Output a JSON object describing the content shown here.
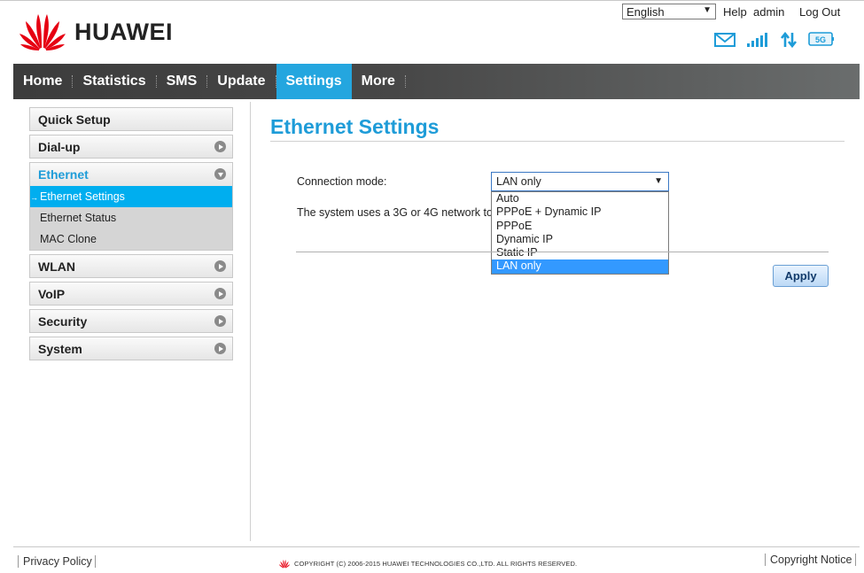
{
  "brand": {
    "name": "HUAWEI"
  },
  "header": {
    "language": "English",
    "help": "Help",
    "user": "admin",
    "logout": "Log Out",
    "network_badge": "5G"
  },
  "nav": {
    "items": [
      {
        "label": "Home",
        "active": false
      },
      {
        "label": "Statistics",
        "active": false
      },
      {
        "label": "SMS",
        "active": false
      },
      {
        "label": "Update",
        "active": false
      },
      {
        "label": "Settings",
        "active": true
      },
      {
        "label": "More",
        "active": false
      }
    ]
  },
  "sidebar": {
    "quick_setup": "Quick Setup",
    "dialup": "Dial-up",
    "ethernet": "Ethernet",
    "ethernet_sub": [
      "Ethernet Settings",
      "Ethernet Status",
      "MAC Clone"
    ],
    "active_arrow": "→",
    "wlan": "WLAN",
    "voip": "VoIP",
    "security": "Security",
    "system": "System"
  },
  "content": {
    "title": "Ethernet Settings",
    "connection_mode_label": "Connection mode:",
    "connection_mode_value": "LAN only",
    "connection_mode_options": [
      "Auto",
      "PPPoE + Dynamic IP",
      "PPPoE",
      "Dynamic IP",
      "Static IP",
      "LAN only"
    ],
    "description": "The system uses a 3G or 4G network to c",
    "apply": "Apply"
  },
  "footer": {
    "privacy": "Privacy Policy",
    "copyright": "COPYRIGHT (C) 2006-2015 HUAWEI TECHNOLOGIES CO.,LTD. ALL RIGHTS RESERVED.",
    "notice": "Copyright Notice"
  },
  "colors": {
    "accent": "#24a6df",
    "selected": "#3399ff"
  }
}
